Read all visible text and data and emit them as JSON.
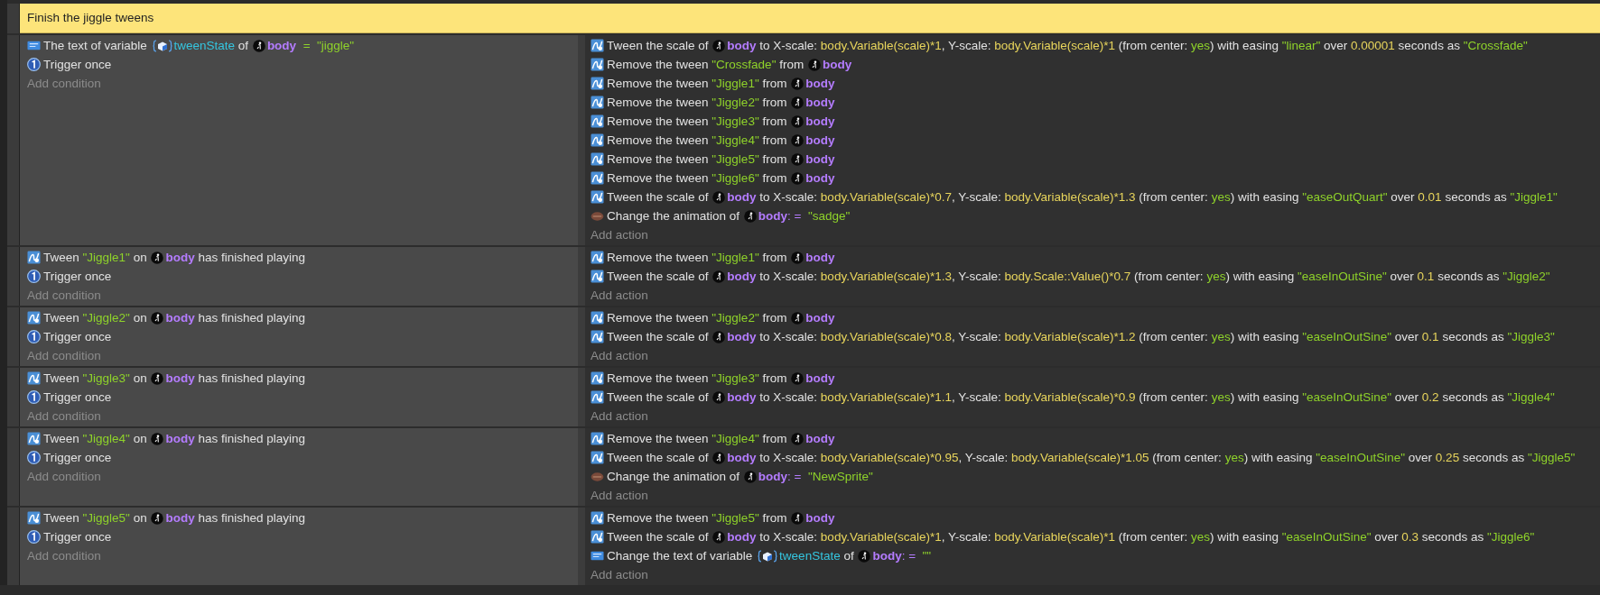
{
  "comment": {
    "text": "Finish the jiggle tweens"
  },
  "events": [
    {
      "conditions": [
        {
          "kind": "variable",
          "parts": [
            {
              "kind": "text",
              "text": "The text of variable "
            },
            {
              "kind": "variable",
              "text": "tweenState"
            },
            {
              "kind": "text",
              "text": " of "
            },
            {
              "kind": "object",
              "text": "body"
            },
            {
              "kind": "string",
              "text": "  =  \"jiggle\""
            }
          ]
        },
        {
          "kind": "trigger",
          "parts": [
            {
              "kind": "text",
              "text": "Trigger once"
            }
          ]
        }
      ],
      "add_condition": "Add condition",
      "actions": [
        {
          "kind": "tween",
          "parts": [
            {
              "kind": "text",
              "text": "Tween the scale of "
            },
            {
              "kind": "object",
              "text": "body"
            },
            {
              "kind": "text",
              "text": " to X-scale: "
            },
            {
              "kind": "expression",
              "text": "body.Variable(scale)*1"
            },
            {
              "kind": "text",
              "text": ", Y-scale: "
            },
            {
              "kind": "expression",
              "text": "body.Variable(scale)*1"
            },
            {
              "kind": "text",
              "text": " (from center: "
            },
            {
              "kind": "string",
              "text": "yes"
            },
            {
              "kind": "text",
              "text": ") with easing "
            },
            {
              "kind": "string",
              "text": "\"linear\""
            },
            {
              "kind": "text",
              "text": " over "
            },
            {
              "kind": "expression",
              "text": "0.00001"
            },
            {
              "kind": "text",
              "text": " seconds as "
            },
            {
              "kind": "string",
              "text": "\"Crossfade\""
            }
          ]
        },
        {
          "kind": "tween",
          "parts": [
            {
              "kind": "text",
              "text": "Remove the tween "
            },
            {
              "kind": "string",
              "text": "\"Crossfade\""
            },
            {
              "kind": "text",
              "text": " from "
            },
            {
              "kind": "object",
              "text": "body"
            }
          ]
        },
        {
          "kind": "tween",
          "parts": [
            {
              "kind": "text",
              "text": "Remove the tween "
            },
            {
              "kind": "string",
              "text": "\"Jiggle1\""
            },
            {
              "kind": "text",
              "text": " from "
            },
            {
              "kind": "object",
              "text": "body"
            }
          ]
        },
        {
          "kind": "tween",
          "parts": [
            {
              "kind": "text",
              "text": "Remove the tween "
            },
            {
              "kind": "string",
              "text": "\"Jiggle2\""
            },
            {
              "kind": "text",
              "text": " from "
            },
            {
              "kind": "object",
              "text": "body"
            }
          ]
        },
        {
          "kind": "tween",
          "parts": [
            {
              "kind": "text",
              "text": "Remove the tween "
            },
            {
              "kind": "string",
              "text": "\"Jiggle3\""
            },
            {
              "kind": "text",
              "text": " from "
            },
            {
              "kind": "object",
              "text": "body"
            }
          ]
        },
        {
          "kind": "tween",
          "parts": [
            {
              "kind": "text",
              "text": "Remove the tween "
            },
            {
              "kind": "string",
              "text": "\"Jiggle4\""
            },
            {
              "kind": "text",
              "text": " from "
            },
            {
              "kind": "object",
              "text": "body"
            }
          ]
        },
        {
          "kind": "tween",
          "parts": [
            {
              "kind": "text",
              "text": "Remove the tween "
            },
            {
              "kind": "string",
              "text": "\"Jiggle5\""
            },
            {
              "kind": "text",
              "text": " from "
            },
            {
              "kind": "object",
              "text": "body"
            }
          ]
        },
        {
          "kind": "tween",
          "parts": [
            {
              "kind": "text",
              "text": "Remove the tween "
            },
            {
              "kind": "string",
              "text": "\"Jiggle6\""
            },
            {
              "kind": "text",
              "text": " from "
            },
            {
              "kind": "object",
              "text": "body"
            }
          ]
        },
        {
          "kind": "tween",
          "parts": [
            {
              "kind": "text",
              "text": "Tween the scale of "
            },
            {
              "kind": "object",
              "text": "body"
            },
            {
              "kind": "text",
              "text": " to X-scale: "
            },
            {
              "kind": "expression",
              "text": "body.Variable(scale)*0.7"
            },
            {
              "kind": "text",
              "text": ", Y-scale: "
            },
            {
              "kind": "expression",
              "text": "body.Variable(scale)*1.3"
            },
            {
              "kind": "text",
              "text": " (from center: "
            },
            {
              "kind": "string",
              "text": "yes"
            },
            {
              "kind": "text",
              "text": ") with easing "
            },
            {
              "kind": "string",
              "text": "\"easeOutQuart\""
            },
            {
              "kind": "text",
              "text": " over "
            },
            {
              "kind": "expression",
              "text": "0.01"
            },
            {
              "kind": "text",
              "text": " seconds as "
            },
            {
              "kind": "string",
              "text": "\"Jiggle1\""
            }
          ]
        },
        {
          "kind": "animation",
          "parts": [
            {
              "kind": "text",
              "text": "Change the animation of "
            },
            {
              "kind": "object",
              "text": "body"
            },
            {
              "kind": "operator",
              "text": ": =  "
            },
            {
              "kind": "string",
              "text": "\"sadge\""
            }
          ]
        }
      ],
      "add_action": "Add action"
    },
    {
      "conditions": [
        {
          "kind": "tween",
          "parts": [
            {
              "kind": "text",
              "text": "Tween "
            },
            {
              "kind": "string",
              "text": "\"Jiggle1\""
            },
            {
              "kind": "text",
              "text": " on "
            },
            {
              "kind": "object",
              "text": "body"
            },
            {
              "kind": "text",
              "text": " has finished playing"
            }
          ]
        },
        {
          "kind": "trigger",
          "parts": [
            {
              "kind": "text",
              "text": "Trigger once"
            }
          ]
        }
      ],
      "add_condition": "Add condition",
      "actions": [
        {
          "kind": "tween",
          "parts": [
            {
              "kind": "text",
              "text": "Remove the tween "
            },
            {
              "kind": "string",
              "text": "\"Jiggle1\""
            },
            {
              "kind": "text",
              "text": " from "
            },
            {
              "kind": "object",
              "text": "body"
            }
          ]
        },
        {
          "kind": "tween",
          "parts": [
            {
              "kind": "text",
              "text": "Tween the scale of "
            },
            {
              "kind": "object",
              "text": "body"
            },
            {
              "kind": "text",
              "text": " to X-scale: "
            },
            {
              "kind": "expression",
              "text": "body.Variable(scale)*1.3"
            },
            {
              "kind": "text",
              "text": ", Y-scale: "
            },
            {
              "kind": "expression",
              "text": "body.Scale::Value()*0.7"
            },
            {
              "kind": "text",
              "text": " (from center: "
            },
            {
              "kind": "string",
              "text": "yes"
            },
            {
              "kind": "text",
              "text": ") with easing "
            },
            {
              "kind": "string",
              "text": "\"easeInOutSine\""
            },
            {
              "kind": "text",
              "text": " over "
            },
            {
              "kind": "expression",
              "text": "0.1"
            },
            {
              "kind": "text",
              "text": " seconds as "
            },
            {
              "kind": "string",
              "text": "\"Jiggle2\""
            }
          ]
        }
      ],
      "add_action": "Add action"
    },
    {
      "conditions": [
        {
          "kind": "tween",
          "parts": [
            {
              "kind": "text",
              "text": "Tween "
            },
            {
              "kind": "string",
              "text": "\"Jiggle2\""
            },
            {
              "kind": "text",
              "text": " on "
            },
            {
              "kind": "object",
              "text": "body"
            },
            {
              "kind": "text",
              "text": " has finished playing"
            }
          ]
        },
        {
          "kind": "trigger",
          "parts": [
            {
              "kind": "text",
              "text": "Trigger once"
            }
          ]
        }
      ],
      "add_condition": "Add condition",
      "actions": [
        {
          "kind": "tween",
          "parts": [
            {
              "kind": "text",
              "text": "Remove the tween "
            },
            {
              "kind": "string",
              "text": "\"Jiggle2\""
            },
            {
              "kind": "text",
              "text": " from "
            },
            {
              "kind": "object",
              "text": "body"
            }
          ]
        },
        {
          "kind": "tween",
          "parts": [
            {
              "kind": "text",
              "text": "Tween the scale of "
            },
            {
              "kind": "object",
              "text": "body"
            },
            {
              "kind": "text",
              "text": " to X-scale: "
            },
            {
              "kind": "expression",
              "text": "body.Variable(scale)*0.8"
            },
            {
              "kind": "text",
              "text": ", Y-scale: "
            },
            {
              "kind": "expression",
              "text": "body.Variable(scale)*1.2"
            },
            {
              "kind": "text",
              "text": " (from center: "
            },
            {
              "kind": "string",
              "text": "yes"
            },
            {
              "kind": "text",
              "text": ") with easing "
            },
            {
              "kind": "string",
              "text": "\"easeInOutSine\""
            },
            {
              "kind": "text",
              "text": " over "
            },
            {
              "kind": "expression",
              "text": "0.1"
            },
            {
              "kind": "text",
              "text": " seconds as "
            },
            {
              "kind": "string",
              "text": "\"Jiggle3\""
            }
          ]
        }
      ],
      "add_action": "Add action"
    },
    {
      "conditions": [
        {
          "kind": "tween",
          "parts": [
            {
              "kind": "text",
              "text": "Tween "
            },
            {
              "kind": "string",
              "text": "\"Jiggle3\""
            },
            {
              "kind": "text",
              "text": " on "
            },
            {
              "kind": "object",
              "text": "body"
            },
            {
              "kind": "text",
              "text": " has finished playing"
            }
          ]
        },
        {
          "kind": "trigger",
          "parts": [
            {
              "kind": "text",
              "text": "Trigger once"
            }
          ]
        }
      ],
      "add_condition": "Add condition",
      "actions": [
        {
          "kind": "tween",
          "parts": [
            {
              "kind": "text",
              "text": "Remove the tween "
            },
            {
              "kind": "string",
              "text": "\"Jiggle3\""
            },
            {
              "kind": "text",
              "text": " from "
            },
            {
              "kind": "object",
              "text": "body"
            }
          ]
        },
        {
          "kind": "tween",
          "parts": [
            {
              "kind": "text",
              "text": "Tween the scale of "
            },
            {
              "kind": "object",
              "text": "body"
            },
            {
              "kind": "text",
              "text": " to X-scale: "
            },
            {
              "kind": "expression",
              "text": "body.Variable(scale)*1.1"
            },
            {
              "kind": "text",
              "text": ", Y-scale: "
            },
            {
              "kind": "expression",
              "text": "body.Variable(scale)*0.9"
            },
            {
              "kind": "text",
              "text": " (from center: "
            },
            {
              "kind": "string",
              "text": "yes"
            },
            {
              "kind": "text",
              "text": ") with easing "
            },
            {
              "kind": "string",
              "text": "\"easeInOutSine\""
            },
            {
              "kind": "text",
              "text": " over "
            },
            {
              "kind": "expression",
              "text": "0.2"
            },
            {
              "kind": "text",
              "text": " seconds as "
            },
            {
              "kind": "string",
              "text": "\"Jiggle4\""
            }
          ]
        }
      ],
      "add_action": "Add action"
    },
    {
      "conditions": [
        {
          "kind": "tween",
          "parts": [
            {
              "kind": "text",
              "text": "Tween "
            },
            {
              "kind": "string",
              "text": "\"Jiggle4\""
            },
            {
              "kind": "text",
              "text": " on "
            },
            {
              "kind": "object",
              "text": "body"
            },
            {
              "kind": "text",
              "text": " has finished playing"
            }
          ]
        },
        {
          "kind": "trigger",
          "parts": [
            {
              "kind": "text",
              "text": "Trigger once"
            }
          ]
        }
      ],
      "add_condition": "Add condition",
      "actions": [
        {
          "kind": "tween",
          "parts": [
            {
              "kind": "text",
              "text": "Remove the tween "
            },
            {
              "kind": "string",
              "text": "\"Jiggle4\""
            },
            {
              "kind": "text",
              "text": " from "
            },
            {
              "kind": "object",
              "text": "body"
            }
          ]
        },
        {
          "kind": "tween",
          "parts": [
            {
              "kind": "text",
              "text": "Tween the scale of "
            },
            {
              "kind": "object",
              "text": "body"
            },
            {
              "kind": "text",
              "text": " to X-scale: "
            },
            {
              "kind": "expression",
              "text": "body.Variable(scale)*0.95"
            },
            {
              "kind": "text",
              "text": ", Y-scale: "
            },
            {
              "kind": "expression",
              "text": "body.Variable(scale)*1.05"
            },
            {
              "kind": "text",
              "text": " (from center: "
            },
            {
              "kind": "string",
              "text": "yes"
            },
            {
              "kind": "text",
              "text": ") with easing "
            },
            {
              "kind": "string",
              "text": "\"easeInOutSine\""
            },
            {
              "kind": "text",
              "text": " over "
            },
            {
              "kind": "expression",
              "text": "0.25"
            },
            {
              "kind": "text",
              "text": " seconds as "
            },
            {
              "kind": "string",
              "text": "\"Jiggle5\""
            }
          ]
        },
        {
          "kind": "animation",
          "parts": [
            {
              "kind": "text",
              "text": "Change the animation of "
            },
            {
              "kind": "object",
              "text": "body"
            },
            {
              "kind": "operator",
              "text": ": =  "
            },
            {
              "kind": "string",
              "text": "\"NewSprite\""
            }
          ]
        }
      ],
      "add_action": "Add action"
    },
    {
      "conditions": [
        {
          "kind": "tween",
          "parts": [
            {
              "kind": "text",
              "text": "Tween "
            },
            {
              "kind": "string",
              "text": "\"Jiggle5\""
            },
            {
              "kind": "text",
              "text": " on "
            },
            {
              "kind": "object",
              "text": "body"
            },
            {
              "kind": "text",
              "text": " has finished playing"
            }
          ]
        },
        {
          "kind": "trigger",
          "parts": [
            {
              "kind": "text",
              "text": "Trigger once"
            }
          ]
        }
      ],
      "add_condition": "Add condition",
      "actions": [
        {
          "kind": "tween",
          "parts": [
            {
              "kind": "text",
              "text": "Remove the tween "
            },
            {
              "kind": "string",
              "text": "\"Jiggle5\""
            },
            {
              "kind": "text",
              "text": " from "
            },
            {
              "kind": "object",
              "text": "body"
            }
          ]
        },
        {
          "kind": "tween",
          "parts": [
            {
              "kind": "text",
              "text": "Tween the scale of "
            },
            {
              "kind": "object",
              "text": "body"
            },
            {
              "kind": "text",
              "text": " to X-scale: "
            },
            {
              "kind": "expression",
              "text": "body.Variable(scale)*1"
            },
            {
              "kind": "text",
              "text": ", Y-scale: "
            },
            {
              "kind": "expression",
              "text": "body.Variable(scale)*1"
            },
            {
              "kind": "text",
              "text": " (from center: "
            },
            {
              "kind": "string",
              "text": "yes"
            },
            {
              "kind": "text",
              "text": ") with easing "
            },
            {
              "kind": "string",
              "text": "\"easeInOutSine\""
            },
            {
              "kind": "text",
              "text": " over "
            },
            {
              "kind": "expression",
              "text": "0.3"
            },
            {
              "kind": "text",
              "text": " seconds as "
            },
            {
              "kind": "string",
              "text": "\"Jiggle6\""
            }
          ]
        },
        {
          "kind": "variable",
          "parts": [
            {
              "kind": "text",
              "text": "Change the text of variable "
            },
            {
              "kind": "variable",
              "text": "tweenState"
            },
            {
              "kind": "text",
              "text": " of "
            },
            {
              "kind": "object",
              "text": "body"
            },
            {
              "kind": "operator",
              "text": ": =  "
            },
            {
              "kind": "string",
              "text": "\"\""
            }
          ]
        }
      ],
      "add_action": "Add action"
    }
  ]
}
